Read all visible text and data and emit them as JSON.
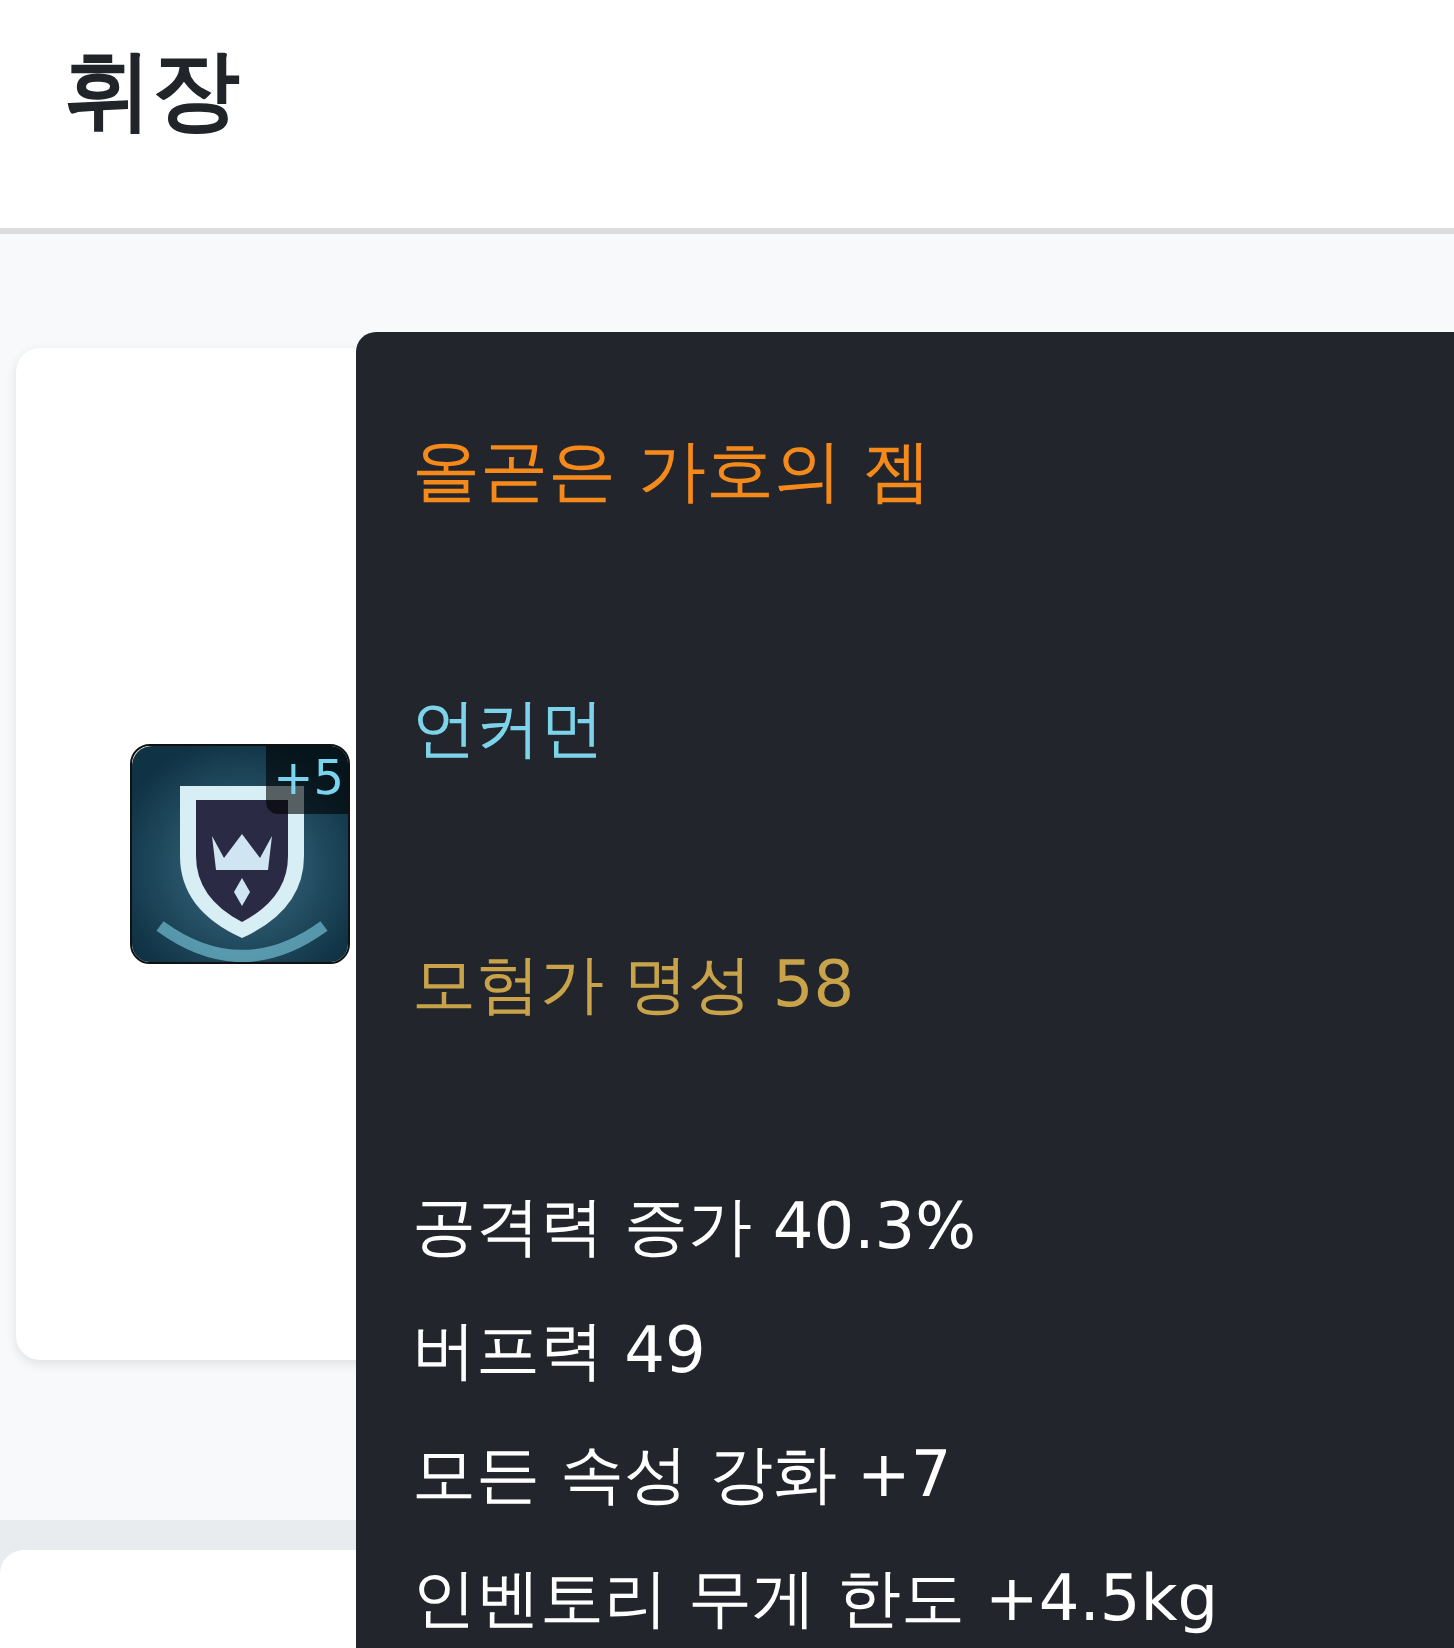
{
  "header": {
    "title": "휘장"
  },
  "item": {
    "badge": "+5"
  },
  "tooltip": {
    "name": "올곧은 가호의 젬",
    "rarity": "언커먼",
    "fame": "모험가 명성 58",
    "stats": [
      "공격력 증가 40.3%",
      "버프력 49",
      "모든 속성 강화 +7",
      "인벤토리 무게 한도 +4.5kg"
    ]
  }
}
